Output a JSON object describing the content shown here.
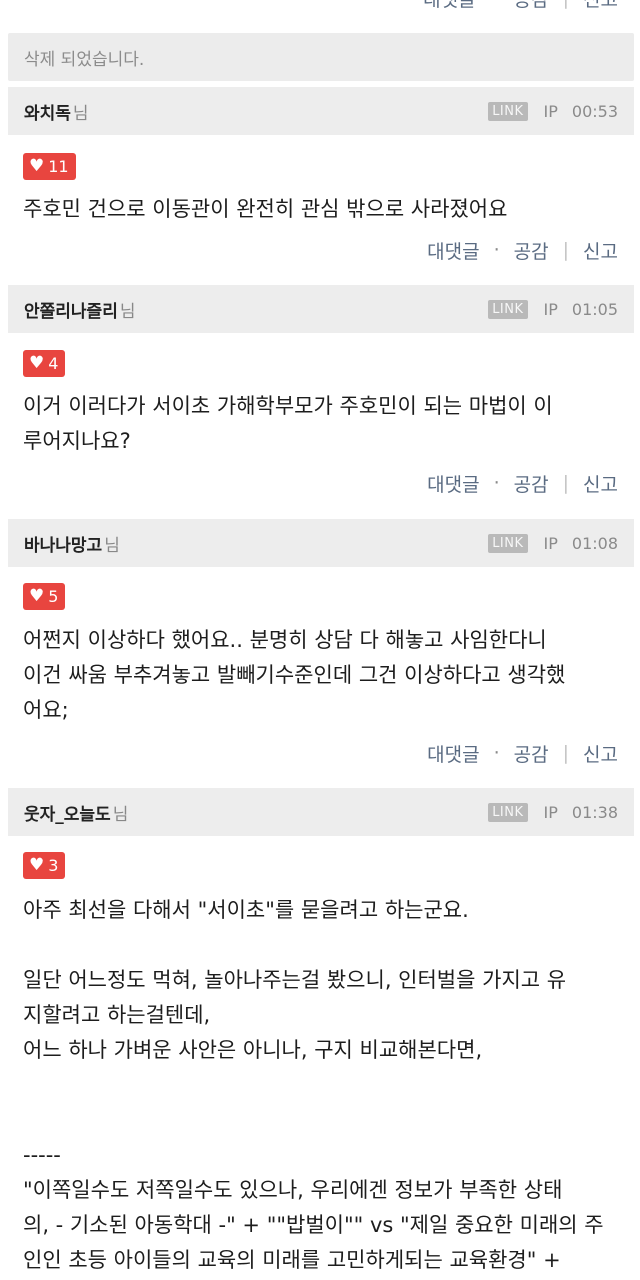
{
  "top_actions": {
    "reply": "대댓글",
    "like": "공감",
    "report": "신고"
  },
  "deleted_notice": "삭제 되었습니다.",
  "common": {
    "nim": "님",
    "link": "LINK",
    "ip": "IP",
    "reply": "대댓글",
    "like": "공감",
    "report": "신고",
    "heart": "♥"
  },
  "comments": [
    {
      "nick": "와치독",
      "time": "00:53",
      "likes": "11",
      "text": "주호민 건으로 이동관이 완전히 관심 밖으로 사라졌어요"
    },
    {
      "nick": "안쫄리나즐리",
      "time": "01:05",
      "likes": "4",
      "text": "이거 이러다가 서이초 가해학부모가 주호민이 되는 마법이 이\n루어지나요?"
    },
    {
      "nick": "바나나망고",
      "time": "01:08",
      "likes": "5",
      "text": "어쩐지 이상하다 했어요.. 분명히 상담 다 해놓고 사임한다니\n이건 싸움 부추겨놓고 발빼기수준인데 그건 이상하다고 생각했\n어요;"
    },
    {
      "nick": "웃자_오늘도",
      "time": "01:38",
      "likes": "3",
      "text": "아주 최선을 다해서 \"서이초\"를 묻을려고 하는군요.\n\n일단 어느정도 먹혀, 놀아나주는걸 봤으니, 인터벌을 가지고 유\n지할려고 하는걸텐데,\n어느 하나 가벼운 사안은 아니나, 구지 비교해본다면,\n\n\n-----\n\"이쪽일수도 저쪽일수도 있으나, 우리에겐 정보가 부족한 상태\n의, - 기소된 아동학대 -\" + \"\"밥벌이\"\" vs \"제일 중요한 미래의 주\n인인 초등 아이들의 교육의 미래를 고민하게되는 교육환경\" +\n\"\"죽음\"\""
    }
  ]
}
